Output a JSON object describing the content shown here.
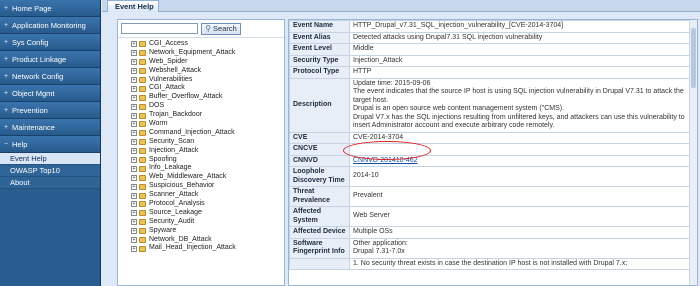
{
  "nav": {
    "items": [
      {
        "label": "Home Page",
        "expander": "+"
      },
      {
        "label": "Application Monitoring",
        "expander": "+"
      },
      {
        "label": "Sys Config",
        "expander": "+"
      },
      {
        "label": "Product Linkage",
        "expander": "+"
      },
      {
        "label": "Network Config",
        "expander": "+"
      },
      {
        "label": "Object Mgmt",
        "expander": "+"
      },
      {
        "label": "Prevention",
        "expander": "+"
      },
      {
        "label": "Maintenance",
        "expander": "+"
      },
      {
        "label": "Help",
        "expander": "−"
      }
    ],
    "subitems": [
      {
        "label": "Event Help",
        "active": true
      },
      {
        "label": "OWASP Top10",
        "active": false
      },
      {
        "label": "About",
        "active": false
      }
    ]
  },
  "tab": {
    "label": "Event Help"
  },
  "search": {
    "placeholder": "",
    "button_label": "Search"
  },
  "tree": [
    "CGI_Access",
    "Network_Equipment_Attack",
    "Web_Spider",
    "Webshell_Attack",
    "Vulnerabilities",
    "CGI_Attack",
    "Buffer_Overflow_Attack",
    "DOS",
    "Trojan_Backdoor",
    "Worm",
    "Command_Injection_Attack",
    "Security_Scan",
    "Injection_Attack",
    "Spoofing",
    "Info_Leakage",
    "Web_Middleware_Attack",
    "Suspicious_Behavior",
    "Scanner_Attack",
    "Protocol_Analysis",
    "Source_Leakage",
    "Security_Audit",
    "Spyware",
    "Network_DB_Attack",
    "Mail_Head_Injection_Attack"
  ],
  "details": [
    {
      "key": "Event Name",
      "value": "HTTP_Drupal_v7.31_SQL_injection_vulnerability_[CVE-2014-3704]"
    },
    {
      "key": "Event Alias",
      "value": "Detected attacks using Drupal7.31 SQL injection vulnerability"
    },
    {
      "key": "Event Level",
      "value": "Middle"
    },
    {
      "key": "Security Type",
      "value": "Injection_Attack"
    },
    {
      "key": "Protocol Type",
      "value": "HTTP"
    },
    {
      "key": "Description",
      "value": "Update time: 2015-09-06\nThe event indicates that the source IP host is using SQL injection vulnerability in Drupal V7.31 to attack the target host.\nDrupal is an open source web content management system (\"CMS).\nDrupal V7.x has the SQL injections resulting from unfiltered keys, and attackers can use this vulnerability to insert Administrator account and execute arbitrary code remotely."
    },
    {
      "key": "CVE",
      "value": "CVE-2014-3704"
    },
    {
      "key": "CNCVE",
      "value": ""
    },
    {
      "key": "CNNVD",
      "value": "CNNVD-201410-462",
      "link": true
    },
    {
      "key": "Loophole Discovery Time",
      "value": "2014-10"
    },
    {
      "key": "Threat Prevalence",
      "value": "Prevalent"
    },
    {
      "key": "Affected System",
      "value": "Web Server"
    },
    {
      "key": "Affected Device",
      "value": "Multiple OSs"
    },
    {
      "key": "Software Fingerprint Info",
      "value": "Other application:\nDrupal 7.31-7.0x"
    },
    {
      "key": "",
      "value": "1. No security threat exists in case the destination IP host is not installed with Drupal 7.x;"
    }
  ],
  "colors": {
    "nav_bg": "#2a5d8f",
    "highlight_circle": "#dd2222",
    "link": "#1b4fa0"
  }
}
